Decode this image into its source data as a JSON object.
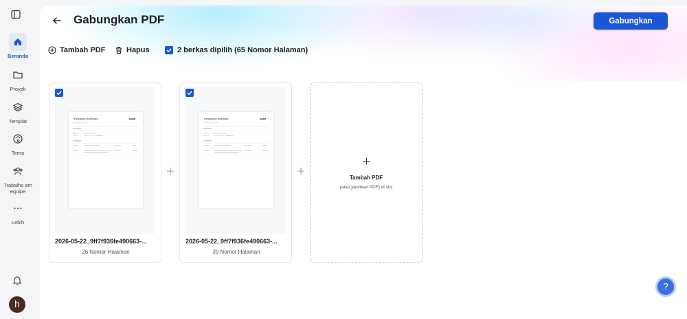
{
  "sidebar": {
    "items": [
      {
        "label": "Beranda",
        "icon": "home-icon"
      },
      {
        "label": "Proyek",
        "icon": "folder-icon"
      },
      {
        "label": "Templat",
        "icon": "layers-icon"
      },
      {
        "label": "Tema",
        "icon": "palette-icon"
      },
      {
        "label": "Trabalho em equipe",
        "icon": "team-icon"
      },
      {
        "label": "Lebih",
        "icon": "more-icon"
      }
    ],
    "avatar_initial": "h"
  },
  "header": {
    "title": "Gabungkan PDF",
    "merge_label": "Gabungkan"
  },
  "toolbar": {
    "add_label": "Tambah PDF",
    "delete_label": "Hapus",
    "selected_label": "2 berkas dipilih (65 Nomor Halaman)"
  },
  "files": [
    {
      "name": "2026-05-22_9ff7f936fe490663-...",
      "pages": "26 Nomor Halaman",
      "checked": true,
      "thumb": {
        "title": "Transaction summary",
        "brand": "upbit"
      }
    },
    {
      "name": "2026-05-22_9ff7f936fe490663-...",
      "pages": "39 Nomor Halaman",
      "checked": true,
      "thumb": {
        "title": "Transaction summary",
        "brand": "upbit"
      }
    }
  ],
  "add_card": {
    "label": "Tambah PDF",
    "sublabel": "(atau jatuhkan PDF) di sini"
  },
  "help": {
    "label": "?"
  },
  "colors": {
    "accent": "#1b56d6",
    "background": "#f4f5f7"
  }
}
